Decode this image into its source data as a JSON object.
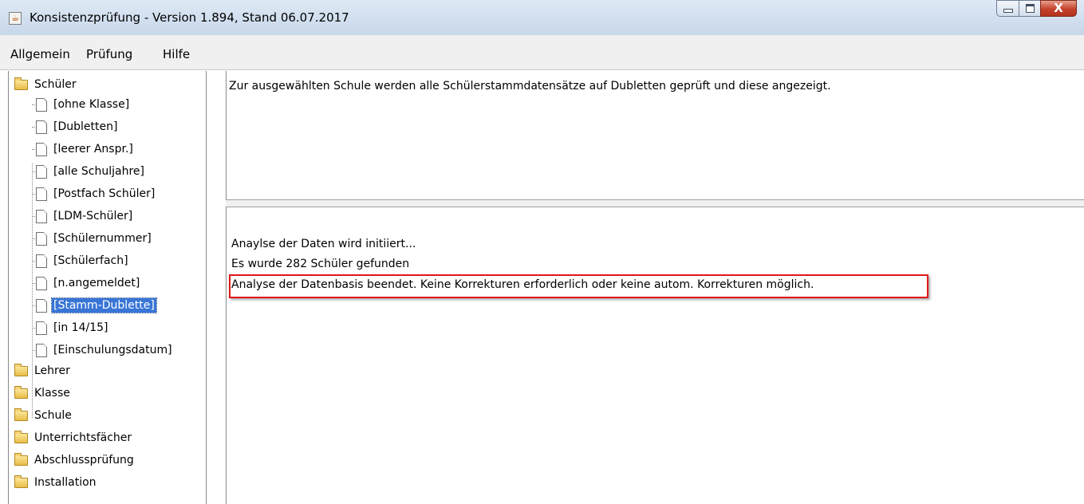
{
  "window": {
    "title": "Konsistenzprüfung - Version 1.894, Stand 06.07.2017",
    "close_glyph": "X"
  },
  "menu": {
    "items": [
      "Allgemein",
      "Prüfung",
      "Hilfe"
    ]
  },
  "tree": {
    "root_folders": [
      "Schüler",
      "Lehrer",
      "Klasse",
      "Schule",
      "Unterrichtsfächer",
      "Abschlussprüfung",
      "Installation"
    ],
    "schueler_children": [
      "[ohne Klasse]",
      "[Dubletten]",
      "[leerer Anspr.]",
      "[alle Schuljahre]",
      "[Postfach Schüler]",
      "[LDM-Schüler]",
      "[Schülernummer]",
      "[Schülerfach]",
      "[n.angemeldet]",
      "[Stamm-Dublette]",
      "[in 14/15]",
      "[Einschulungsdatum]"
    ],
    "selected": "[Stamm-Dublette]"
  },
  "description": {
    "text": "Zur ausgewählten Schule werden alle Schülerstammdatensätze auf Dubletten geprüft und diese angezeigt."
  },
  "log": {
    "lines": [
      "Anaylse der Daten wird initiiert...",
      "Es wurde 282 Schüler gefunden",
      "Analyse der Datenbasis beendet. Keine Korrekturen erforderlich oder keine autom. Korrekturen möglich."
    ],
    "highlight_color": "#e01818"
  },
  "colors": {
    "selection": "#3875d6",
    "titlebar": "#c7d7ea",
    "close_button": "#c4412b"
  },
  "icons": [
    "app-icon",
    "minimize-icon",
    "maximize-icon",
    "close-icon",
    "folder-icon",
    "document-icon"
  ]
}
